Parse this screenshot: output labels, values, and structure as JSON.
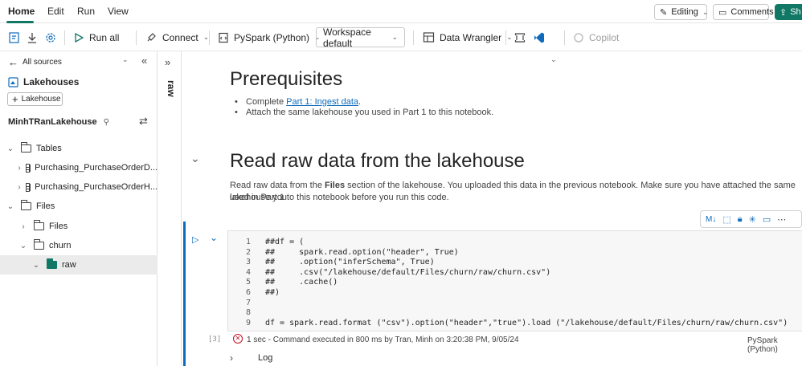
{
  "menubar": {
    "tabs": [
      "Home",
      "Edit",
      "Run",
      "View"
    ],
    "editing_label": "Editing",
    "comments_label": "Comments",
    "share_label": "Sh"
  },
  "toolbar": {
    "run_all": "Run all",
    "connect": "Connect",
    "language": "PySpark (Python)",
    "workspace": "Workspace default",
    "data_wrangler": "Data Wrangler",
    "copilot": "Copilot"
  },
  "leftpanel": {
    "back_label": "All sources",
    "lakehouses_title": "Lakehouses",
    "add_lakehouse": "Lakehouse",
    "lakehouse_name": "MinhTRanLakehouse",
    "tree": {
      "tables": "Tables",
      "table1": "Purchasing_PurchaseOrderD...",
      "table2": "Purchasing_PurchaseOrderH...",
      "files": "Files",
      "files_sub": "Files",
      "churn": "churn",
      "raw": "raw"
    }
  },
  "strip": {
    "label": "raw"
  },
  "notebook": {
    "prereq_title": "Prerequisites",
    "bullet1_prefix": "Complete ",
    "bullet1_link": "Part 1: Ingest data",
    "bullet1_suffix": ".",
    "bullet2": "Attach the same lakehouse you used in Part 1 to this notebook.",
    "section_title": "Read raw data from the lakehouse",
    "section_p1_a": "Read raw data from the ",
    "section_p1_bold": "Files",
    "section_p1_b": " section of the lakehouse. You uploaded this data in the previous notebook. Make sure you have attached the same lakehouse you",
    "section_p2": "used in Part 1 to this notebook before you run this code.",
    "line_numbers": [
      "1",
      "2",
      "3",
      "4",
      "5",
      "6",
      "7",
      "8",
      "9"
    ],
    "code_lines": [
      "##df = (",
      "##     spark.read.option(\"header\", True)",
      "##     .option(\"inferSchema\", True)",
      "##     .csv(\"/lakehouse/default/Files/churn/raw/churn.csv\")",
      "##     .cache()",
      "##)",
      "",
      "",
      "df = spark.read.format (\"csv\").option(\"header\",\"true\").load (\"/lakehouse/default/Files/churn/raw/churn.csv\")"
    ],
    "exec_count": "[3]",
    "status_text": "1 sec - Command executed in 800 ms by Tran, Minh on 3:20:38 PM, 9/05/24",
    "status_lang": "PySpark (Python)",
    "log_label": "Log",
    "cell_toolbar_md": "M↓"
  }
}
